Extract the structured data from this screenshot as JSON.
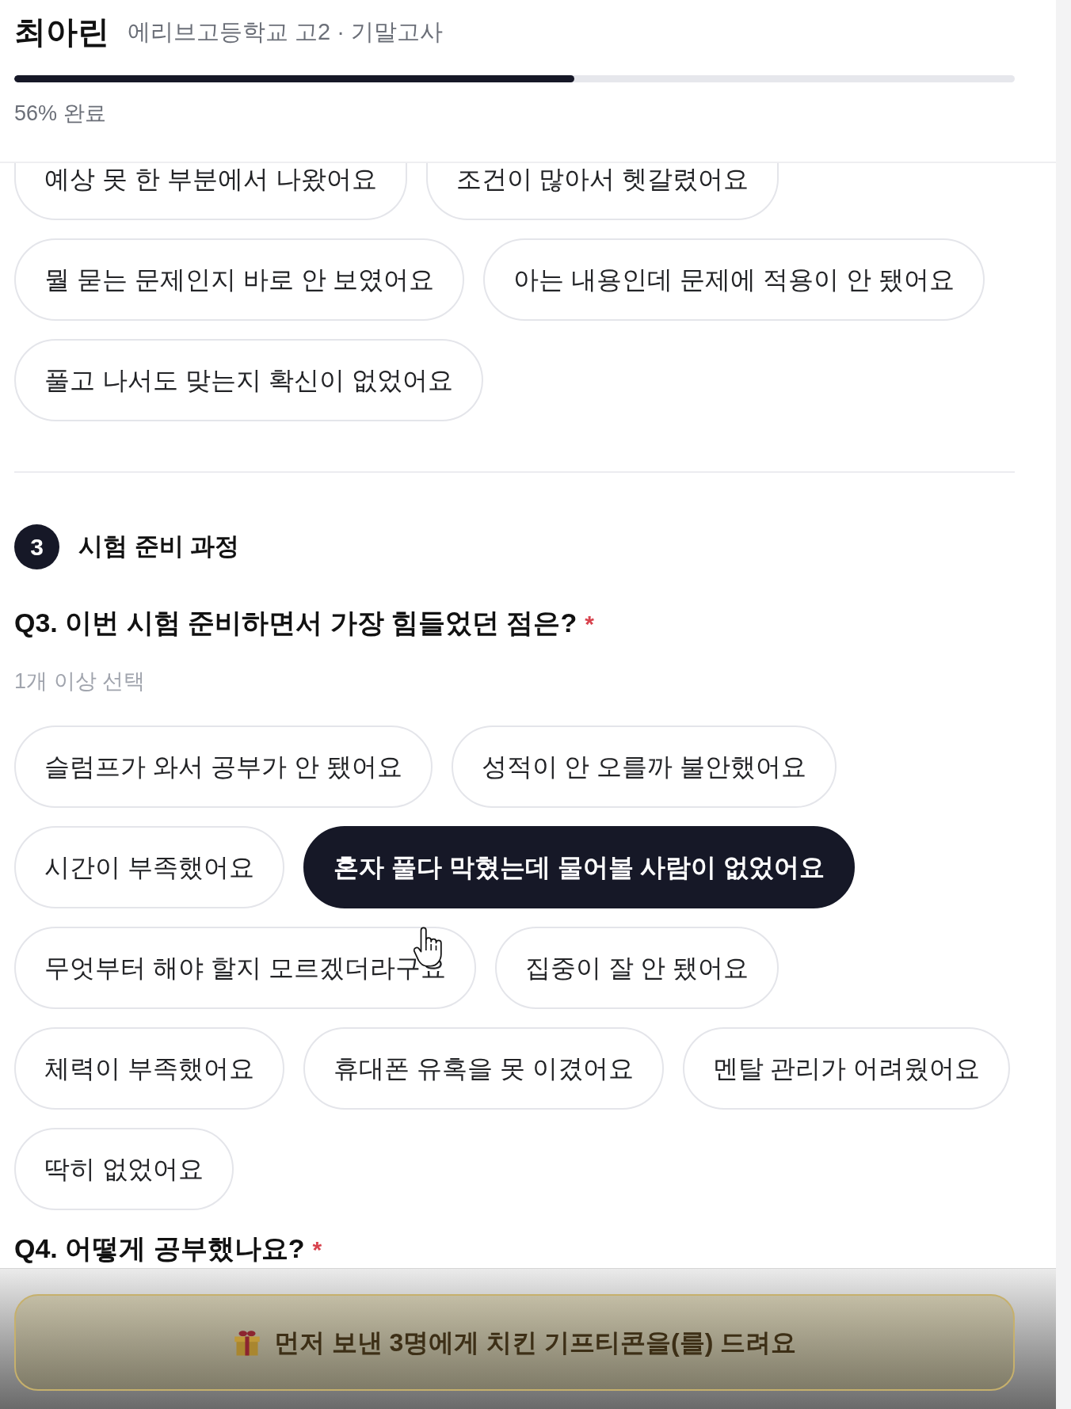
{
  "header": {
    "student_name": "최아린",
    "subtitle": "에리브고등학교 고2 · 기말고사",
    "progress": {
      "level": 0.56,
      "label": "56% 완료"
    }
  },
  "previous_question": {
    "option_rows": [
      [
        {
          "label": "예상 못 한 부분에서 나왔어요",
          "selected": false
        },
        {
          "label": "조건이 많아서 헷갈렸어요",
          "selected": false
        }
      ],
      [
        {
          "label": "뭘 묻는 문제인지 바로 안 보였어요",
          "selected": false
        },
        {
          "label": "아는 내용인데 문제에 적용이 안 됐어요",
          "selected": false
        }
      ],
      [
        {
          "label": "풀고 나서도 맞는지 확신이 없었어요",
          "selected": false
        }
      ]
    ]
  },
  "section": {
    "number": "3",
    "title": "시험 준비 과정"
  },
  "questions": [
    {
      "title": "Q3. 이번 시험 준비하면서 가장 힘들었던 점은?",
      "required_mark": "*",
      "hint": "1개 이상 선택",
      "options": [
        {
          "label": "슬럼프가 와서 공부가 안 됐어요",
          "selected": false
        },
        {
          "label": "성적이 안 오를까 불안했어요",
          "selected": false
        },
        {
          "label": "시간이 부족했어요",
          "selected": false
        },
        {
          "label": "혼자 풀다 막혔는데 물어볼 사람이 없었어요",
          "selected": true
        },
        {
          "label": "무엇부터 해야 할지 모르겠더라구요",
          "selected": false
        },
        {
          "label": "집중이 잘 안 됐어요",
          "selected": false
        },
        {
          "label": "체력이 부족했어요",
          "selected": false
        },
        {
          "label": "휴대폰 유혹을 못 이겼어요",
          "selected": false
        },
        {
          "label": "멘탈 관리가 어려웠어요",
          "selected": false
        },
        {
          "label": "딱히 없었어요",
          "selected": false
        }
      ]
    },
    {
      "title": "Q4. 어떻게 공부했나요?",
      "required_mark": "*"
    }
  ],
  "footer": {
    "banner": "먼저 보낸 3명에게 치킨 기프티콘을(를) 드려요"
  }
}
